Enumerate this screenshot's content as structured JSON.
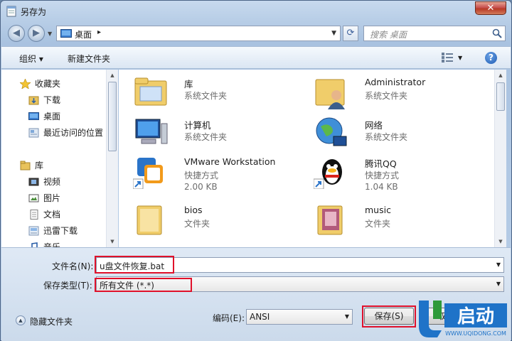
{
  "window": {
    "title": "另存为",
    "close_label": "✕"
  },
  "address": {
    "location": "桌面",
    "separator": "▸"
  },
  "search": {
    "placeholder": "搜索 桌面"
  },
  "toolbar": {
    "organize": "组织 ▾",
    "new_folder": "新建文件夹"
  },
  "navpane": {
    "items": [
      {
        "label": "收藏夹",
        "icon": "star-icon"
      },
      {
        "label": "下载",
        "icon": "download-folder-icon"
      },
      {
        "label": "桌面",
        "icon": "desktop-icon"
      },
      {
        "label": "最近访问的位置",
        "icon": "recent-places-icon"
      },
      {
        "label": "库",
        "icon": "library-icon"
      },
      {
        "label": "视频",
        "icon": "video-icon"
      },
      {
        "label": "图片",
        "icon": "pictures-icon"
      },
      {
        "label": "文档",
        "icon": "documents-icon"
      },
      {
        "label": "迅雷下载",
        "icon": "thunder-download-icon"
      },
      {
        "label": "音乐",
        "icon": "music-icon"
      }
    ]
  },
  "files": [
    {
      "name": "库",
      "type": "系统文件夹",
      "size": "",
      "icon": "library-folder-icon"
    },
    {
      "name": "Administrator",
      "type": "系统文件夹",
      "size": "",
      "icon": "user-folder-icon"
    },
    {
      "name": "计算机",
      "type": "系统文件夹",
      "size": "",
      "icon": "computer-icon"
    },
    {
      "name": "网络",
      "type": "系统文件夹",
      "size": "",
      "icon": "network-icon"
    },
    {
      "name": "VMware Workstation",
      "type": "快捷方式",
      "size": "2.00 KB",
      "icon": "vmware-icon"
    },
    {
      "name": "腾讯QQ",
      "type": "快捷方式",
      "size": "1.04 KB",
      "icon": "qq-penguin-icon"
    },
    {
      "name": "bios",
      "type": "文件夹",
      "size": "",
      "icon": "folder-icon"
    },
    {
      "name": "music",
      "type": "文件夹",
      "size": "",
      "icon": "music-folder-icon"
    }
  ],
  "form": {
    "filename_label": "文件名(N):",
    "filename_value": "u盘文件恢复.bat",
    "filetype_label": "保存类型(T):",
    "filetype_value": "所有文件 (*.*)",
    "encoding_label": "编码(E):",
    "encoding_value": "ANSI",
    "hide_folders": "隐藏文件夹",
    "save_button": "保存(S)",
    "cancel_button": "取消"
  },
  "watermark": {
    "logo_text": "启动",
    "logo_url": "WWW.UQIDONG.COM"
  },
  "colors": {
    "highlight": "#e0112b",
    "accent": "#1d5bb3",
    "logo_blue": "#1f73c8",
    "logo_green": "#2e9a3a"
  }
}
